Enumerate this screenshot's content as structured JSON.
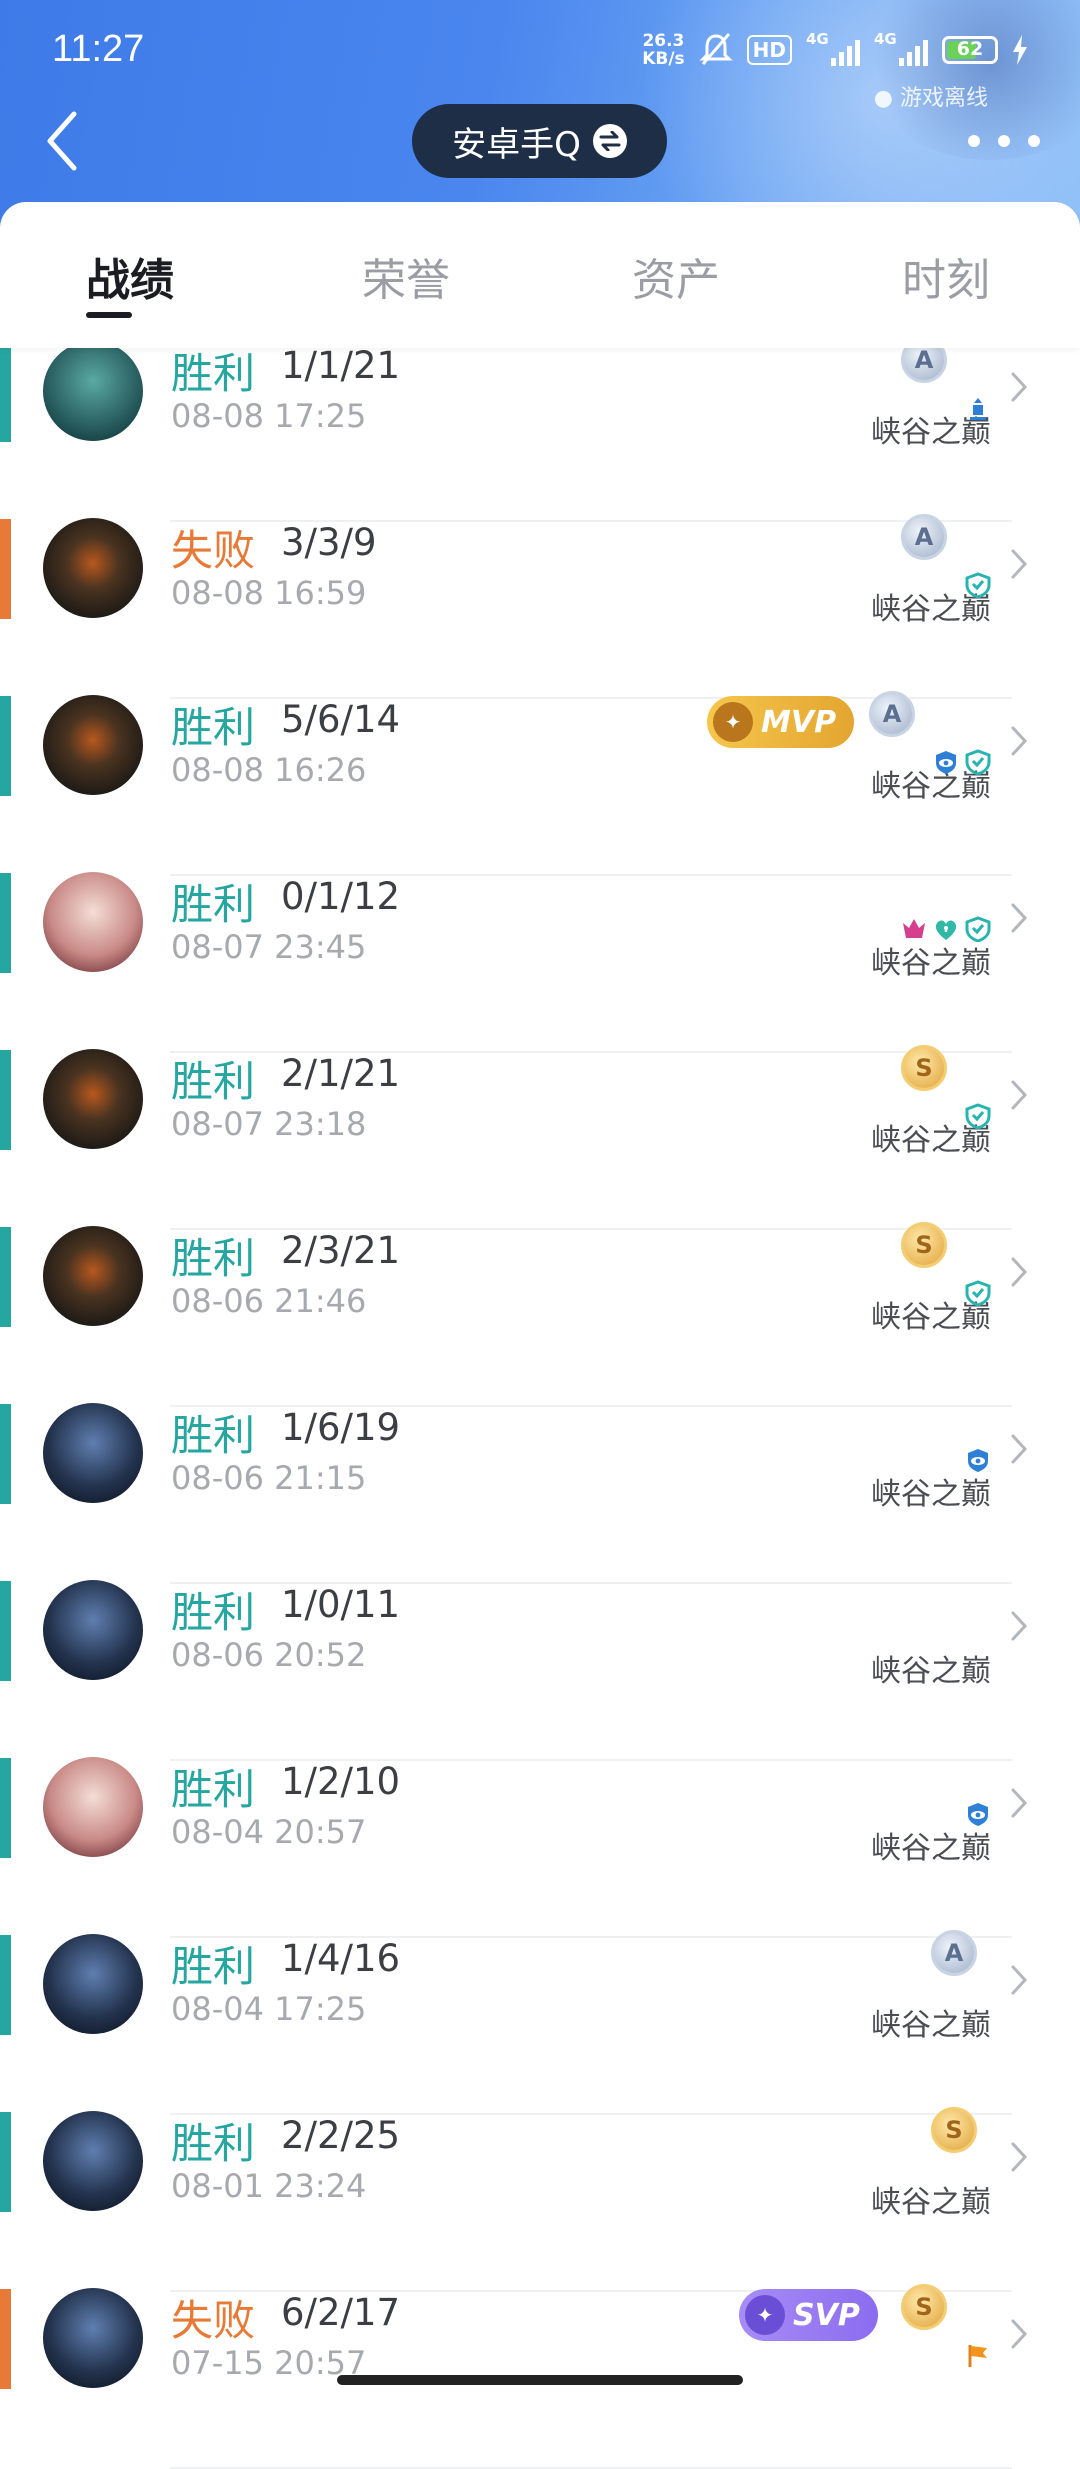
{
  "status_bar": {
    "time": "11:27",
    "net_speed_value": "26.3",
    "net_speed_unit": "KB/s",
    "hd_label": "HD",
    "sim1": "4G",
    "sim2": "4G",
    "battery": "62"
  },
  "header": {
    "offline_text": "游戏离线",
    "title": "安卓手Q"
  },
  "tabs": [
    {
      "label": "战绩",
      "active": true
    },
    {
      "label": "荣誉",
      "active": false
    },
    {
      "label": "资产",
      "active": false
    },
    {
      "label": "时刻",
      "active": false
    }
  ],
  "colors": {
    "win": "#25a6a0",
    "loss": "#e67a36",
    "header_blue": "#4a86ee",
    "mvp_gold": "#e3a531",
    "svp_purple": "#8b6cf0"
  },
  "matches": [
    {
      "result": "胜利",
      "kda": "1/1/21",
      "date": "08-08 17:25",
      "mode": "峡谷之巅",
      "win": true,
      "medal": "A",
      "badge": "",
      "icons": [
        "role-icon"
      ],
      "hero": "teal"
    },
    {
      "result": "失败",
      "kda": "3/3/9",
      "date": "08-08 16:59",
      "mode": "峡谷之巅",
      "win": false,
      "medal": "A",
      "badge": "",
      "icons": [
        "shield-icon"
      ],
      "hero": "dark"
    },
    {
      "result": "胜利",
      "kda": "5/6/14",
      "date": "08-08 16:26",
      "mode": "峡谷之巅",
      "win": true,
      "medal": "A",
      "badge": "MVP",
      "icons": [
        "vision-icon",
        "shield-icon"
      ],
      "hero": "dark"
    },
    {
      "result": "胜利",
      "kda": "0/1/12",
      "date": "08-07 23:45",
      "mode": "峡谷之巅",
      "win": true,
      "medal": "",
      "badge": "",
      "icons": [
        "crown-icon",
        "heal-icon",
        "shield-icon"
      ],
      "hero": "pale"
    },
    {
      "result": "胜利",
      "kda": "2/1/21",
      "date": "08-07 23:18",
      "mode": "峡谷之巅",
      "win": true,
      "medal": "S",
      "badge": "",
      "icons": [
        "shield-icon"
      ],
      "hero": "dark"
    },
    {
      "result": "胜利",
      "kda": "2/3/21",
      "date": "08-06 21:46",
      "mode": "峡谷之巅",
      "win": true,
      "medal": "S",
      "badge": "",
      "icons": [
        "shield-icon"
      ],
      "hero": "dark"
    },
    {
      "result": "胜利",
      "kda": "1/6/19",
      "date": "08-06 21:15",
      "mode": "峡谷之巅",
      "win": true,
      "medal": "",
      "badge": "",
      "icons": [
        "vision-icon"
      ],
      "hero": "blue"
    },
    {
      "result": "胜利",
      "kda": "1/0/11",
      "date": "08-06 20:52",
      "mode": "峡谷之巅",
      "win": true,
      "medal": "",
      "badge": "",
      "icons": [],
      "hero": "blue"
    },
    {
      "result": "胜利",
      "kda": "1/2/10",
      "date": "08-04 20:57",
      "mode": "峡谷之巅",
      "win": true,
      "medal": "",
      "badge": "",
      "icons": [
        "vision-icon"
      ],
      "hero": "pale"
    },
    {
      "result": "胜利",
      "kda": "1/4/16",
      "date": "08-04 17:25",
      "mode": "峡谷之巅",
      "win": true,
      "medal": "A",
      "badge": "",
      "icons": [],
      "hero": "blue"
    },
    {
      "result": "胜利",
      "kda": "2/2/25",
      "date": "08-01 23:24",
      "mode": "峡谷之巅",
      "win": true,
      "medal": "S",
      "badge": "",
      "icons": [],
      "hero": "blue"
    },
    {
      "result": "失败",
      "kda": "6/2/17",
      "date": "07-15 20:57",
      "mode": "",
      "win": false,
      "medal": "S",
      "badge": "SVP",
      "icons": [
        "flag-icon"
      ],
      "hero": "blue"
    }
  ]
}
